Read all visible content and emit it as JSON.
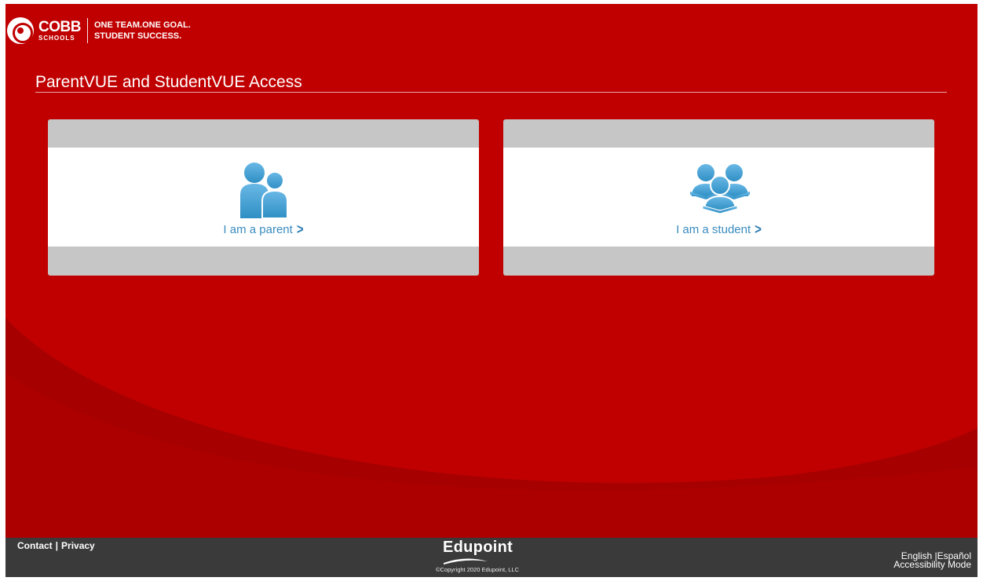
{
  "header": {
    "brand_name": "COBB",
    "brand_sub": "SCHOOLS",
    "tagline_line1": "ONE TEAM.ONE GOAL.",
    "tagline_line2": "STUDENT SUCCESS."
  },
  "main": {
    "title": "ParentVUE and StudentVUE Access",
    "cards": [
      {
        "label": "I am a parent",
        "icon": "parent-icon"
      },
      {
        "label": "I am a student",
        "icon": "students-icon"
      }
    ]
  },
  "footer": {
    "contact": "Contact",
    "separator": "|",
    "privacy": "Privacy",
    "brand": "Edupoint",
    "copyright": "©Copyright 2020 Edupoint, LLC",
    "lang_english": "English",
    "lang_separator": "|",
    "lang_espanol": "Español",
    "accessibility": "Accessibility Mode"
  },
  "colors": {
    "background": "#c00000",
    "background_dark": "#a80000",
    "card_frame": "#c6c6c6",
    "link": "#3a8cbf",
    "footer": "#3a3a3a"
  }
}
